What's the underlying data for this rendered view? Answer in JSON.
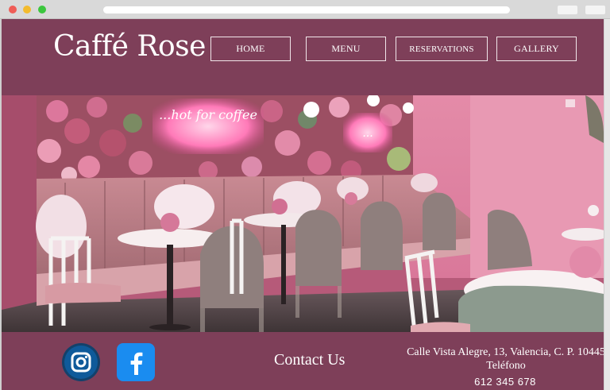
{
  "site": {
    "logo": "Caffé Rose",
    "nav": {
      "home": "HOME",
      "menu": "MENU",
      "reservations": "RESERVATIONS",
      "gallery": "GALLERY"
    }
  },
  "hero": {
    "neon_sign": "...hot for coffee",
    "neon_sign_small": "..."
  },
  "footer": {
    "social_icons": [
      "instagram-icon",
      "facebook-icon"
    ],
    "contact_label": "Contact Us",
    "address": "Calle Vista Alegre, 13, Valencia, C. P. 10445",
    "phone_label": "Teléfono",
    "phone": "612 345 678"
  },
  "colors": {
    "brand_background": "#7e3f59",
    "text": "#ffffff",
    "nav_border": "#f1e6ea"
  }
}
